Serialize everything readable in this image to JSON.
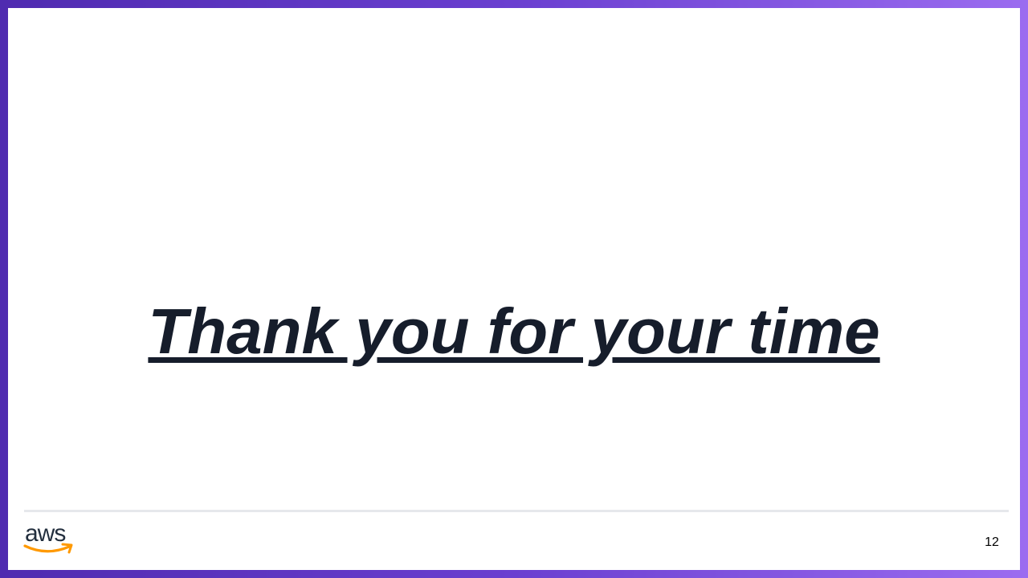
{
  "slide": {
    "title": "Thank you for your time",
    "page_number": "12"
  },
  "branding": {
    "logo_text": "aws",
    "logo_icon": "aws-smile-arrow-icon"
  },
  "colors": {
    "frame_gradient_start": "#4f2bb0",
    "frame_gradient_end": "#9b6cf0",
    "title_text": "#161d2b",
    "logo_text": "#232f3e",
    "logo_smile": "#ff9900"
  }
}
